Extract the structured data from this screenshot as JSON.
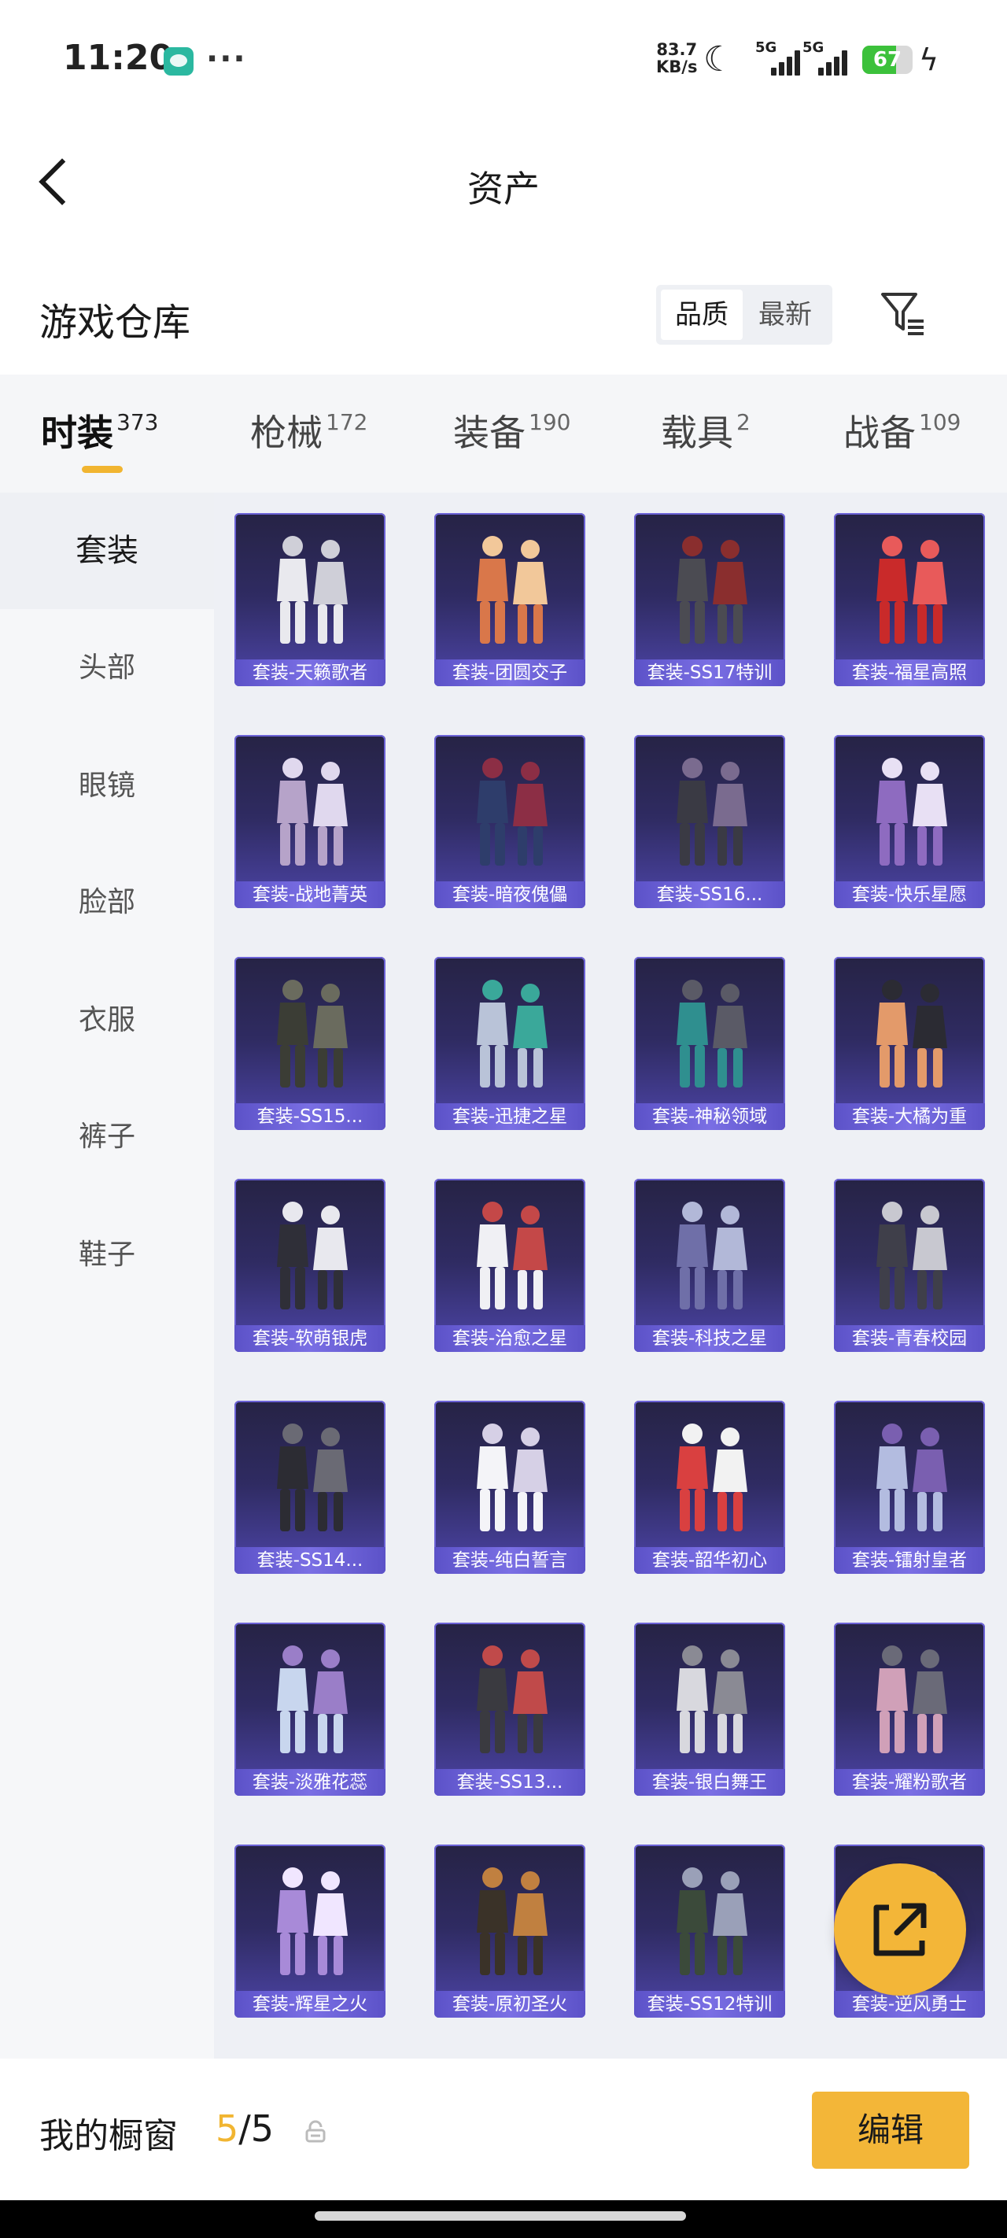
{
  "status_bar": {
    "time": "11:20",
    "net_speed_value": "83.7",
    "net_speed_unit": "KB/s",
    "signal1_label": "5G",
    "signal2_label": "5G",
    "battery": "67",
    "battery_level": 0.67
  },
  "header": {
    "title": "资产"
  },
  "warehouse": {
    "title": "游戏仓库",
    "sort_options": [
      "品质",
      "最新"
    ],
    "active_sort": "品质"
  },
  "tabs": [
    {
      "label": "时装",
      "count": "373"
    },
    {
      "label": "枪械",
      "count": "172"
    },
    {
      "label": "装备",
      "count": "190"
    },
    {
      "label": "载具",
      "count": "2"
    },
    {
      "label": "战备",
      "count": "109"
    }
  ],
  "sidebar": [
    "套装",
    "头部",
    "眼镜",
    "脸部",
    "衣服",
    "裤子",
    "鞋子"
  ],
  "items": [
    "套装-天籁歌者",
    "套装-团圆交子",
    "套装-SS17特训",
    "套装-福星高照",
    "套装-战地菁英",
    "套装-暗夜傀儡",
    "套装-SS16...",
    "套装-快乐星愿",
    "套装-SS15...",
    "套装-迅捷之星",
    "套装-神秘领域",
    "套装-大橘为重",
    "套装-软萌银虎",
    "套装-治愈之星",
    "套装-科技之星",
    "套装-青春校园",
    "套装-SS14...",
    "套装-纯白誓言",
    "套装-韶华初心",
    "套装-镭射皇者",
    "套装-淡雅花蕊",
    "套装-SS13...",
    "套装-银白舞王",
    "套装-耀粉歌者",
    "套装-辉星之火",
    "套装-原初圣火",
    "套装-SS12特训",
    "套装-逆风勇士"
  ],
  "showcase": {
    "label": "我的橱窗",
    "used": "5",
    "separator": "/",
    "total": "5",
    "edit_label": "编辑"
  },
  "colors": {
    "accent": "#f3b638",
    "card_border": "#6b62d6",
    "card_label_bg": "#6a5fd8"
  }
}
